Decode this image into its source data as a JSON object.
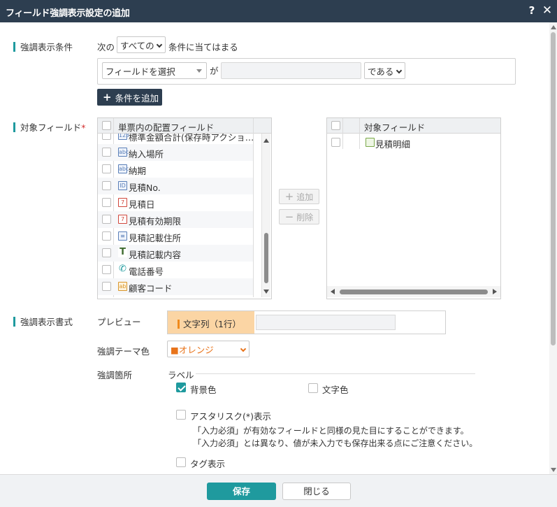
{
  "dialog": {
    "title": "フィールド強調表示設定の追加",
    "help_label": "?",
    "close_label": "✕"
  },
  "condition": {
    "section_label": "強調表示条件",
    "prefix": "次の",
    "match_select": "すべての",
    "suffix": "条件に当てはまる",
    "field_select": "フィールドを選択",
    "particle": "が",
    "value_input": "",
    "operator_select": "である",
    "add_button": "条件を追加"
  },
  "target": {
    "section_label": "対象フィールド",
    "required_mark": "*",
    "left_header": "単票内の配置フィールド",
    "left_items": [
      {
        "label": "標準金額合計(保存時アクショ…",
        "icon": "calc-number-icon"
      },
      {
        "label": "納入場所",
        "icon": "text-field-icon"
      },
      {
        "label": "納期",
        "icon": "text-field-icon"
      },
      {
        "label": "見積No.",
        "icon": "id-field-icon"
      },
      {
        "label": "見積日",
        "icon": "calendar-icon"
      },
      {
        "label": "見積有効期限",
        "icon": "calendar-icon"
      },
      {
        "label": "見積記載住所",
        "icon": "multiline-text-icon"
      },
      {
        "label": "見積記載内容",
        "icon": "rich-text-icon"
      },
      {
        "label": "電話番号",
        "icon": "phone-icon"
      },
      {
        "label": "顧客コード",
        "icon": "lookup-icon"
      }
    ],
    "add_button": "追加",
    "remove_button": "削除",
    "right_header": "対象フィールド",
    "right_items": [
      {
        "label": "見積明細",
        "icon": "table-icon"
      }
    ]
  },
  "style": {
    "section_label": "強調表示書式",
    "preview_label": "プレビュー",
    "preview_tag": "文字列（1行）",
    "theme_label": "強調テーマ色",
    "theme_select": "■オレンジ",
    "theme_color": "#e8731a",
    "location_label": "強調箇所",
    "label_group": "ラベル",
    "bg_color_option": "背景色",
    "bg_color_checked": true,
    "text_color_option": "文字色",
    "text_color_checked": false,
    "asterisk_option": "アスタリスク(*)表示",
    "asterisk_note_1": "「入力必須」が有効なフィールドと同様の見た目にすることができます。",
    "asterisk_note_2": "「入力必須」とは異なり、値が未入力でも保存出来る点にご注意ください。",
    "tag_option": "タグ表示"
  },
  "footer": {
    "save_button": "保存",
    "close_button": "閉じる"
  },
  "colors": {
    "titlebar": "#2d3e50",
    "accent": "#1f9a9e",
    "preview_bg": "#fbd5a4"
  }
}
